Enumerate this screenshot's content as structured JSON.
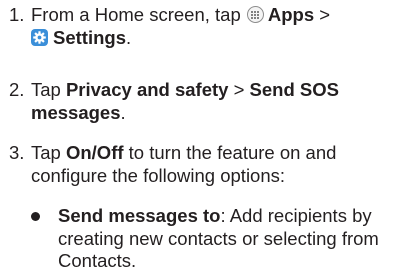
{
  "steps": [
    {
      "number": "1.",
      "text_before": "From a Home screen, tap",
      "apps_label": "Apps",
      "separator": ">",
      "settings_label": "Settings",
      "end": "."
    },
    {
      "number": "2.",
      "text_before": "Tap",
      "item1": "Privacy and safety",
      "separator": ">",
      "item2": "Send SOS messages",
      "end": "."
    },
    {
      "number": "3.",
      "text_before": "Tap",
      "item": "On/Off",
      "text_after": "to turn the feature on and configure the following options:"
    }
  ],
  "bullets": [
    {
      "label": "Send messages to",
      "text": ": Add recipients by creating new contacts or selecting from Contacts."
    }
  ],
  "icons": {
    "apps": "apps-grid-icon",
    "settings": "gear-icon"
  },
  "colors": {
    "text": "#231f20",
    "settings_icon_bg": "#3b8fd9"
  }
}
